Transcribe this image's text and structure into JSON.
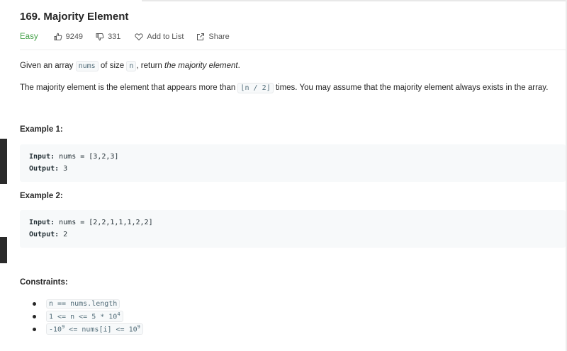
{
  "problem": {
    "title": "169. Majority Element",
    "difficulty": "Easy",
    "likes": "9249",
    "dislikes": "331",
    "add_to_list": "Add to List",
    "share": "Share"
  },
  "description": {
    "p1_prefix": "Given an array ",
    "p1_code1": "nums",
    "p1_mid": " of size ",
    "p1_code2": "n",
    "p1_mid2": ", return ",
    "p1_emph": "the majority element",
    "p1_suffix": ".",
    "p2_prefix": "The majority element is the element that appears more than ",
    "p2_code": "⌊n / 2⌋",
    "p2_suffix": " times. You may assume that the majority element always exists in the array."
  },
  "examples": [
    {
      "heading": "Example 1:",
      "input_label": "Input:",
      "input_value": " nums = [3,2,3]",
      "output_label": "Output:",
      "output_value": " 3"
    },
    {
      "heading": "Example 2:",
      "input_label": "Input:",
      "input_value": " nums = [2,2,1,1,1,2,2]",
      "output_label": "Output:",
      "output_value": " 2"
    }
  ],
  "constraints": {
    "heading": "Constraints:",
    "c1": "n == nums.length",
    "c2_base": "1 <= n <= 5 * 10",
    "c2_exp": "4",
    "c3_a": "-10",
    "c3_a_exp": "9",
    "c3_b": " <= nums[i] <= 10",
    "c3_b_exp": "9"
  },
  "colors": {
    "easy": "#43a047",
    "text": "#262626",
    "code_bg": "#f7f9fa"
  },
  "icons": [
    "thumbs-up-icon",
    "thumbs-down-icon",
    "heart-icon",
    "share-icon"
  ]
}
